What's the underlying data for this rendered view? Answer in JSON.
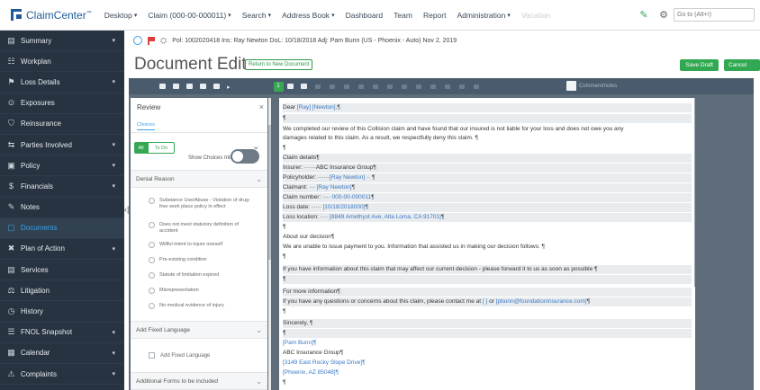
{
  "topbar": {
    "logo": "ClaimCenter",
    "logo_tm": "™",
    "nav": [
      {
        "label": "Desktop",
        "caret": "▾"
      },
      {
        "label": "Claim (000-00-000011)",
        "caret": "▾"
      },
      {
        "label": "Search",
        "caret": "▾"
      },
      {
        "label": "Address Book",
        "caret": "▾"
      },
      {
        "label": "Dashboard",
        "caret": ""
      },
      {
        "label": "Team",
        "caret": ""
      },
      {
        "label": "Report",
        "caret": ""
      },
      {
        "label": "Administration",
        "caret": "▾"
      },
      {
        "label": "Vacation",
        "caret": ""
      }
    ],
    "search_placeholder": "Go to (Alt+/)"
  },
  "sidebar": {
    "items": [
      {
        "label": "Summary",
        "icon": "▤",
        "chev": "▾"
      },
      {
        "label": "Workplan",
        "icon": "☷",
        "chev": ""
      },
      {
        "label": "Loss Details",
        "icon": "⚑",
        "chev": "▾"
      },
      {
        "label": "Exposures",
        "icon": "⊙",
        "chev": ""
      },
      {
        "label": "Reinsurance",
        "icon": "⛉",
        "chev": ""
      },
      {
        "label": "Parties Involved",
        "icon": "⇆",
        "chev": "▾"
      },
      {
        "label": "Policy",
        "icon": "▣",
        "chev": "▾"
      },
      {
        "label": "Financials",
        "icon": "$",
        "chev": "▾"
      },
      {
        "label": "Notes",
        "icon": "✎",
        "chev": ""
      },
      {
        "label": "Documents",
        "icon": "▢",
        "chev": ""
      },
      {
        "label": "Plan of Action",
        "icon": "✖",
        "chev": "▾"
      },
      {
        "label": "Services",
        "icon": "▤",
        "chev": ""
      },
      {
        "label": "Litigation",
        "icon": "⚖",
        "chev": ""
      },
      {
        "label": "History",
        "icon": "◷",
        "chev": ""
      },
      {
        "label": "FNOL Snapshot",
        "icon": "☰",
        "chev": "▾"
      },
      {
        "label": "Calendar",
        "icon": "▦",
        "chev": "▾"
      },
      {
        "label": "Complaints",
        "icon": "⚠",
        "chev": "▾"
      }
    ]
  },
  "claim_info": {
    "text": "Pol: 1002020418   Ins: Ray Newton   DoL: 10/18/2018   Adj: Pam Bunn (US - Phoenix - Auto)   Nov 2, 2019"
  },
  "page": {
    "title": "Document Editor",
    "return_label": "Return to New Document",
    "save_label": "Save Draft",
    "cancel_label": "Cancel"
  },
  "toolbar": {
    "comment_label": "Comment/notes",
    "indicator": "1"
  },
  "review": {
    "title": "Review",
    "close": "×",
    "tab": "Choices",
    "pill_all": "All",
    "pill_todo": "To Do",
    "show_label": "Show Choices Inline",
    "section_denial": "Denial Reason",
    "options": [
      "Substance Use/Abuse - Violation of drug-free work place policy in effect",
      "Does not meet statutory definition of accident",
      "Willful intent to injure oneself",
      "Pre-existing condition",
      "Statute of limitation expired",
      "Misrepresentation",
      "No medical evidence of injury"
    ],
    "section_fixed": "Add Fixed Language",
    "checkbox_label": "Add Fixed Language",
    "section_additional": "Additional Forms to be included"
  },
  "document": {
    "greeting_pre": "Dear ",
    "greeting_fields": "[Ray] [Newton],",
    "para1a": "We completed our review of this Collision claim and have found that our insured is not liable for your loss and does not owe you any",
    "para1b": "damages related to this claim. As a result, we respectfully deny this claim.",
    "claim_details": "Claim details",
    "insurer": "Insurer: ······ABC Insurance Group",
    "policyholder_label": "Policyholder: ······",
    "policyholder_value": "[Ray Newton] ·· ",
    "claimant_label": "Claimant: ··· ",
    "claimant_value": "[Ray Newton]",
    "claimnum_label": "Claim number: ···· ",
    "claimnum_value": "000-00-000011",
    "lossdate_label": "Loss date: ····· ",
    "lossdate_value": "[10/18/2018000]",
    "losslocation_label": "Loss location: ···· ",
    "losslocation_value": "[8849 Amethyst Ave, Alta Loma, CA 91701]",
    "about": "About our decision",
    "about_text": "We are unable to issue payment to you. Information that assisted us in making our decision follows:",
    "info_text": "If you have information about this claim that may affect our current decision - please forward it to us as soon as possible",
    "more_info": "For more information",
    "more_info_text_pre": "If you have any questions or concerns about this claim, please contact me at ",
    "more_info_phone": "[ ]",
    "more_info_mid": " or ",
    "more_info_email": "[pbunn@foundationinsurance.com]",
    "sincerely": "Sincerely,",
    "sig_name": "[Pam Bunn]",
    "sig_company": "ABC Insurance Group",
    "sig_street": "[3149 East Rocky Slope Drive]",
    "sig_city": "[Phoenix, AZ 85048]",
    "pilcrow": "¶"
  }
}
